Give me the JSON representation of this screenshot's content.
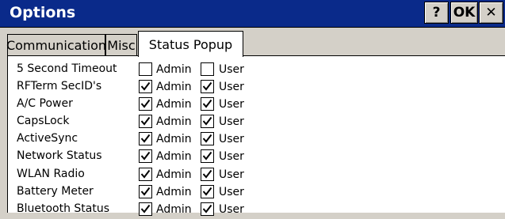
{
  "window": {
    "title": "Options",
    "help_label": "?",
    "ok_label": "OK",
    "close_label": "✕"
  },
  "tabs": [
    {
      "label": "Communication",
      "selected": false
    },
    {
      "label": "Misc",
      "selected": false
    },
    {
      "label": "Status Popup",
      "selected": true
    }
  ],
  "columns": {
    "admin": "Admin",
    "user": "User"
  },
  "rows": [
    {
      "label": "5 Second Timeout",
      "admin": false,
      "user": false
    },
    {
      "label": "RFTerm SecID's",
      "admin": true,
      "user": true
    },
    {
      "label": "A/C Power",
      "admin": true,
      "user": true
    },
    {
      "label": "CapsLock",
      "admin": true,
      "user": true
    },
    {
      "label": "ActiveSync",
      "admin": true,
      "user": true
    },
    {
      "label": "Network Status",
      "admin": true,
      "user": true
    },
    {
      "label": "WLAN Radio",
      "admin": true,
      "user": true
    },
    {
      "label": "Battery Meter",
      "admin": true,
      "user": true
    },
    {
      "label": "Bluetooth Status",
      "admin": true,
      "user": true
    }
  ]
}
